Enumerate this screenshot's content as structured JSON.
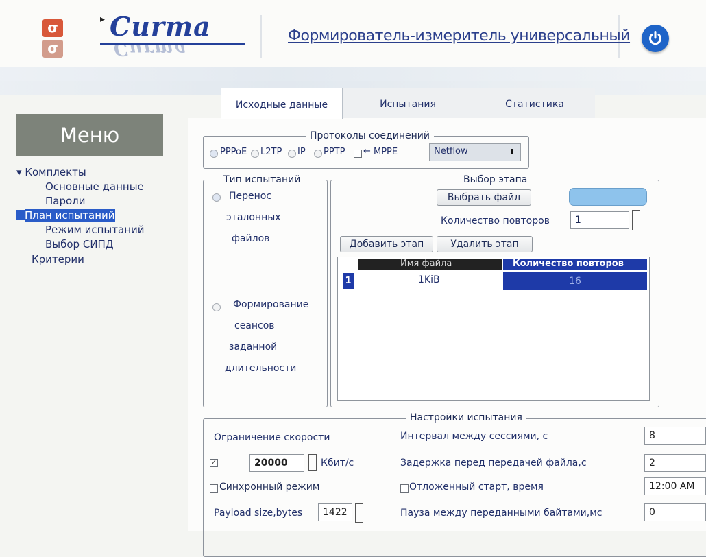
{
  "header": {
    "logo_glyph": "σ",
    "brand": "Curma",
    "app_title": "Формирователь-измеритель универсальный",
    "power_icon": "power-icon",
    "accent": "#1e64c8"
  },
  "sidebar": {
    "menu_title": "Меню",
    "items": [
      {
        "label": "Комплекты",
        "expanded": true
      },
      {
        "label": "Основные данные"
      },
      {
        "label": "Пароли"
      },
      {
        "label": "План испытаний",
        "selected": true
      },
      {
        "label": "Режим испытаний"
      },
      {
        "label": "Выбор СИПД"
      },
      {
        "label": "Критерии"
      }
    ],
    "collapse_glyph": "▾",
    "selection_color": "#2a5cc8"
  },
  "tabs": [
    {
      "label": "Исходные данные",
      "active": true
    },
    {
      "label": "Испытания"
    },
    {
      "label": "Статистика"
    }
  ],
  "protocols": {
    "legend": "Протоколы соединений",
    "options": [
      "PPPoE",
      "L2TP",
      "IP",
      "PPTP"
    ],
    "selected": "PPPoE",
    "mppe_label": "MPPE",
    "mppe_arrow": "←",
    "mppe_checked": false,
    "netflow_value": "Netflow"
  },
  "test_type": {
    "legend": "Тип испытаний",
    "option1": [
      "Перенос",
      "эталонных",
      "файлов"
    ],
    "option2": [
      "Формирование",
      "сеансов",
      "заданной",
      "длительности"
    ]
  },
  "stage": {
    "legend": "Выбор этапа",
    "choose_file_label": "Выбрать файл",
    "repeats_label": "Количество повторов",
    "repeats_value": "1",
    "add_label": "Добавить этап",
    "remove_label": "Удалить этап",
    "table": {
      "columns": [
        "Имя файла",
        "Количество повторов"
      ],
      "rows": [
        {
          "index": "1",
          "file": "1KiB",
          "repeats": "16"
        }
      ]
    }
  },
  "settings": {
    "legend": "Настройки испытания",
    "speed_limit_label": "Ограничение скорости",
    "speed_limit_checked": true,
    "speed_value": "20000",
    "speed_unit": "Кбит/с",
    "sync_label": "Синхронный режим",
    "payload_label": "Payload size,bytes",
    "payload_value": "1422",
    "interval_label": "Интервал между сессиями, с",
    "interval_value": "8",
    "delay_label": "Задержка перед передачей файла,с",
    "delay_value": "2",
    "deferred_label": "Отложенный старт, время",
    "deferred_value": "12:00 AM",
    "pause_label": "Пауза между переданными байтами,мс",
    "pause_value": "0"
  }
}
